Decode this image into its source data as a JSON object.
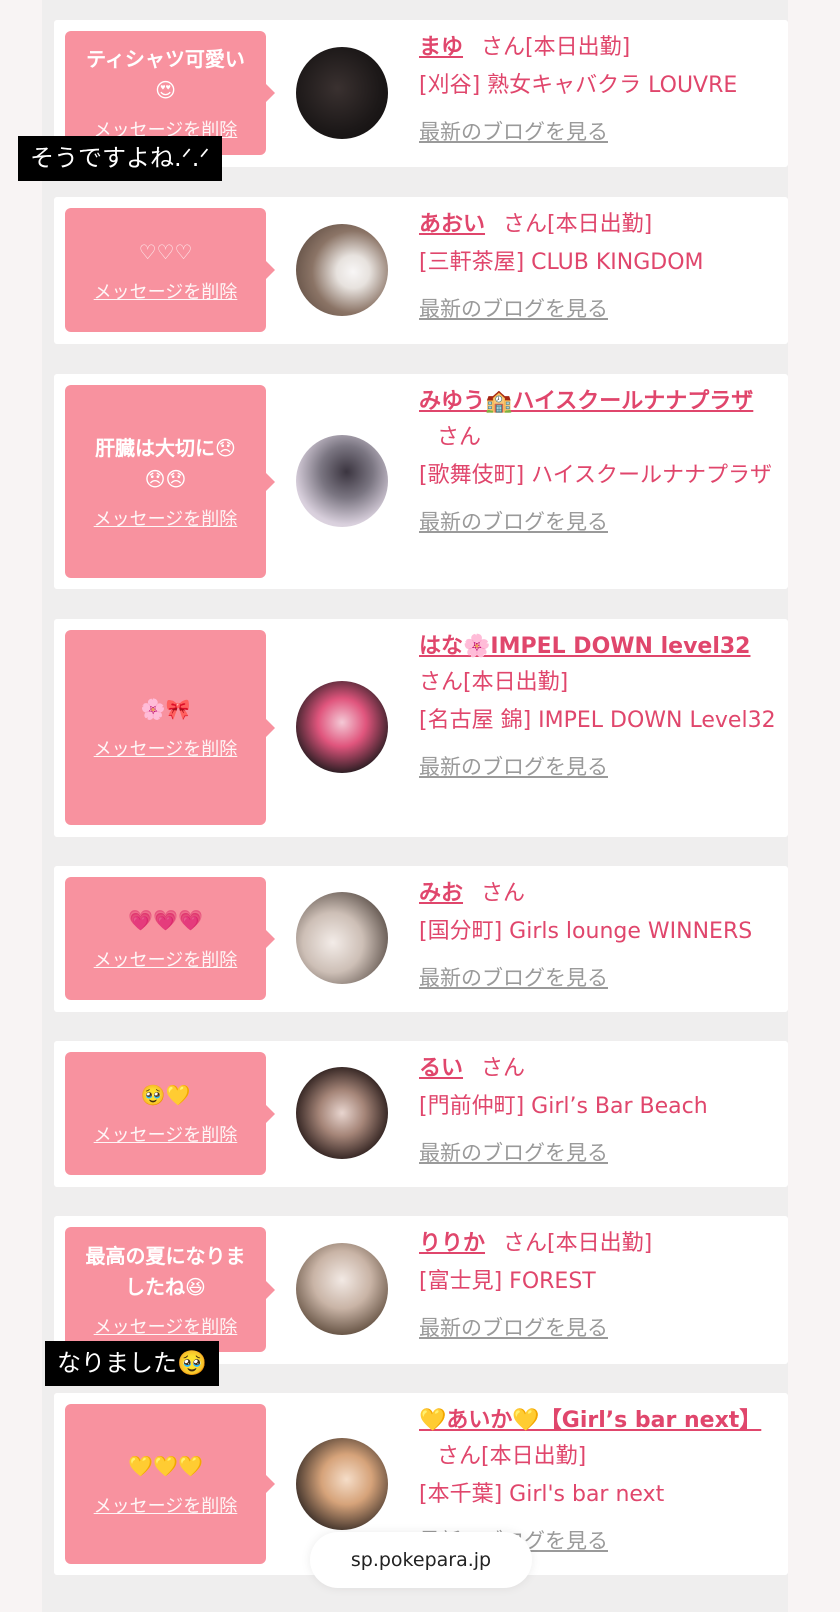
{
  "overlay_captions": [
    "そうですよね.ᐟ.ᐟ",
    "なりました🥹"
  ],
  "browser": {
    "domain": "sp.pokepara.jp"
  },
  "delete_label": "メッセージを削除",
  "blog_label": "最新のブログを見る",
  "san_label": "さん",
  "cards": [
    {
      "message": "ティシャツ可愛い\n😍",
      "name": "まゆ",
      "status": "[本日出勤]",
      "shop": "[刈谷] 熟女キャバクラ LOUVRE"
    },
    {
      "message": "♡♡♡",
      "name": "あおい",
      "status": "[本日出勤]",
      "shop": "[三軒茶屋] CLUB KINGDOM"
    },
    {
      "message": "肝臓は大切に😞\n😞😞",
      "name": "みゆう🏫ハイスクールナナプラザ",
      "status": "",
      "shop": "[歌舞伎町] ハイスクールナナプラザ"
    },
    {
      "message": "🌸🎀",
      "name": "はな🌸IMPEL DOWN level32",
      "status": "[本日出勤]",
      "shop": "[名古屋 錦] IMPEL DOWN Level32"
    },
    {
      "message": "💗💗💗",
      "name": "みお",
      "status": "",
      "shop": "[国分町] Girls lounge WINNERS"
    },
    {
      "message": "🥹💛",
      "name": "るい",
      "status": "",
      "shop": "[門前仲町] Girl’s Bar Beach"
    },
    {
      "message": "最高の夏になりま\nしたね😆",
      "name": "りりか",
      "status": "[本日出勤]",
      "shop": "[富士見] FOREST"
    },
    {
      "message": "💛💛💛",
      "name": "💛あいか💛【Girl’s bar next】",
      "status": "[本日出勤]",
      "shop": "[本千葉] Girl's bar next"
    }
  ]
}
